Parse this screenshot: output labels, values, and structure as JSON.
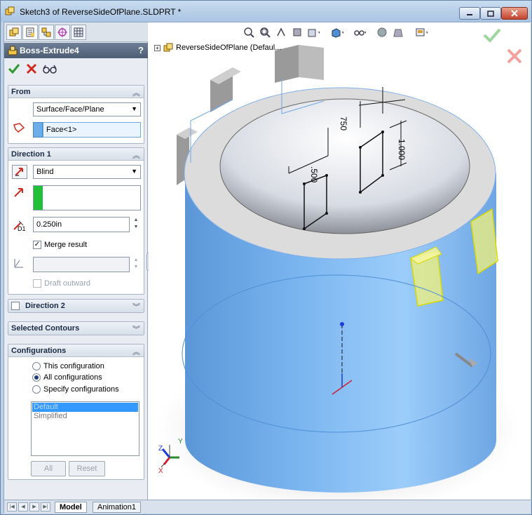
{
  "window": {
    "title": "Sketch3 of ReverseSideOfPlane.SLDPRT *"
  },
  "property_manager": {
    "feature_name": "Boss-Extrude4",
    "help_label": "?",
    "from": {
      "title": "From",
      "type_value": "Surface/Face/Plane",
      "face_value": "Face<1>"
    },
    "direction1": {
      "title": "Direction 1",
      "end_condition": "Blind",
      "depth_value": "0.250in",
      "depth_label": "D1",
      "merge_result_label": "Merge result",
      "merge_result_checked": true,
      "draft_outward_label": "Draft outward",
      "draft_outward_checked": false
    },
    "direction2": {
      "title": "Direction 2",
      "checked": false
    },
    "selected_contours": {
      "title": "Selected Contours"
    },
    "configurations": {
      "title": "Configurations",
      "options": [
        {
          "label": "This configuration",
          "selected": false
        },
        {
          "label": "All configurations",
          "selected": true
        },
        {
          "label": "Specify configurations",
          "selected": false
        }
      ],
      "list": [
        "Default",
        "Simplified"
      ],
      "all_button": "All",
      "reset_button": "Reset"
    }
  },
  "graphics": {
    "tree_root_label": "ReverseSideOfPlane  (Defaul...",
    "dimensions": [
      "750",
      ".500",
      "1.000"
    ],
    "triad_labels": {
      "x": "X",
      "y": "Y",
      "z": "Z"
    }
  },
  "bottom_tabs": {
    "model": "Model",
    "animation": "Animation1"
  },
  "colors": {
    "part_blue": "#7fb8f0",
    "face_gray": "#d8d8d8",
    "preview_yellow": "#f2f27a",
    "ok_green": "#3aa43a",
    "cancel_red": "#d93a2b"
  }
}
